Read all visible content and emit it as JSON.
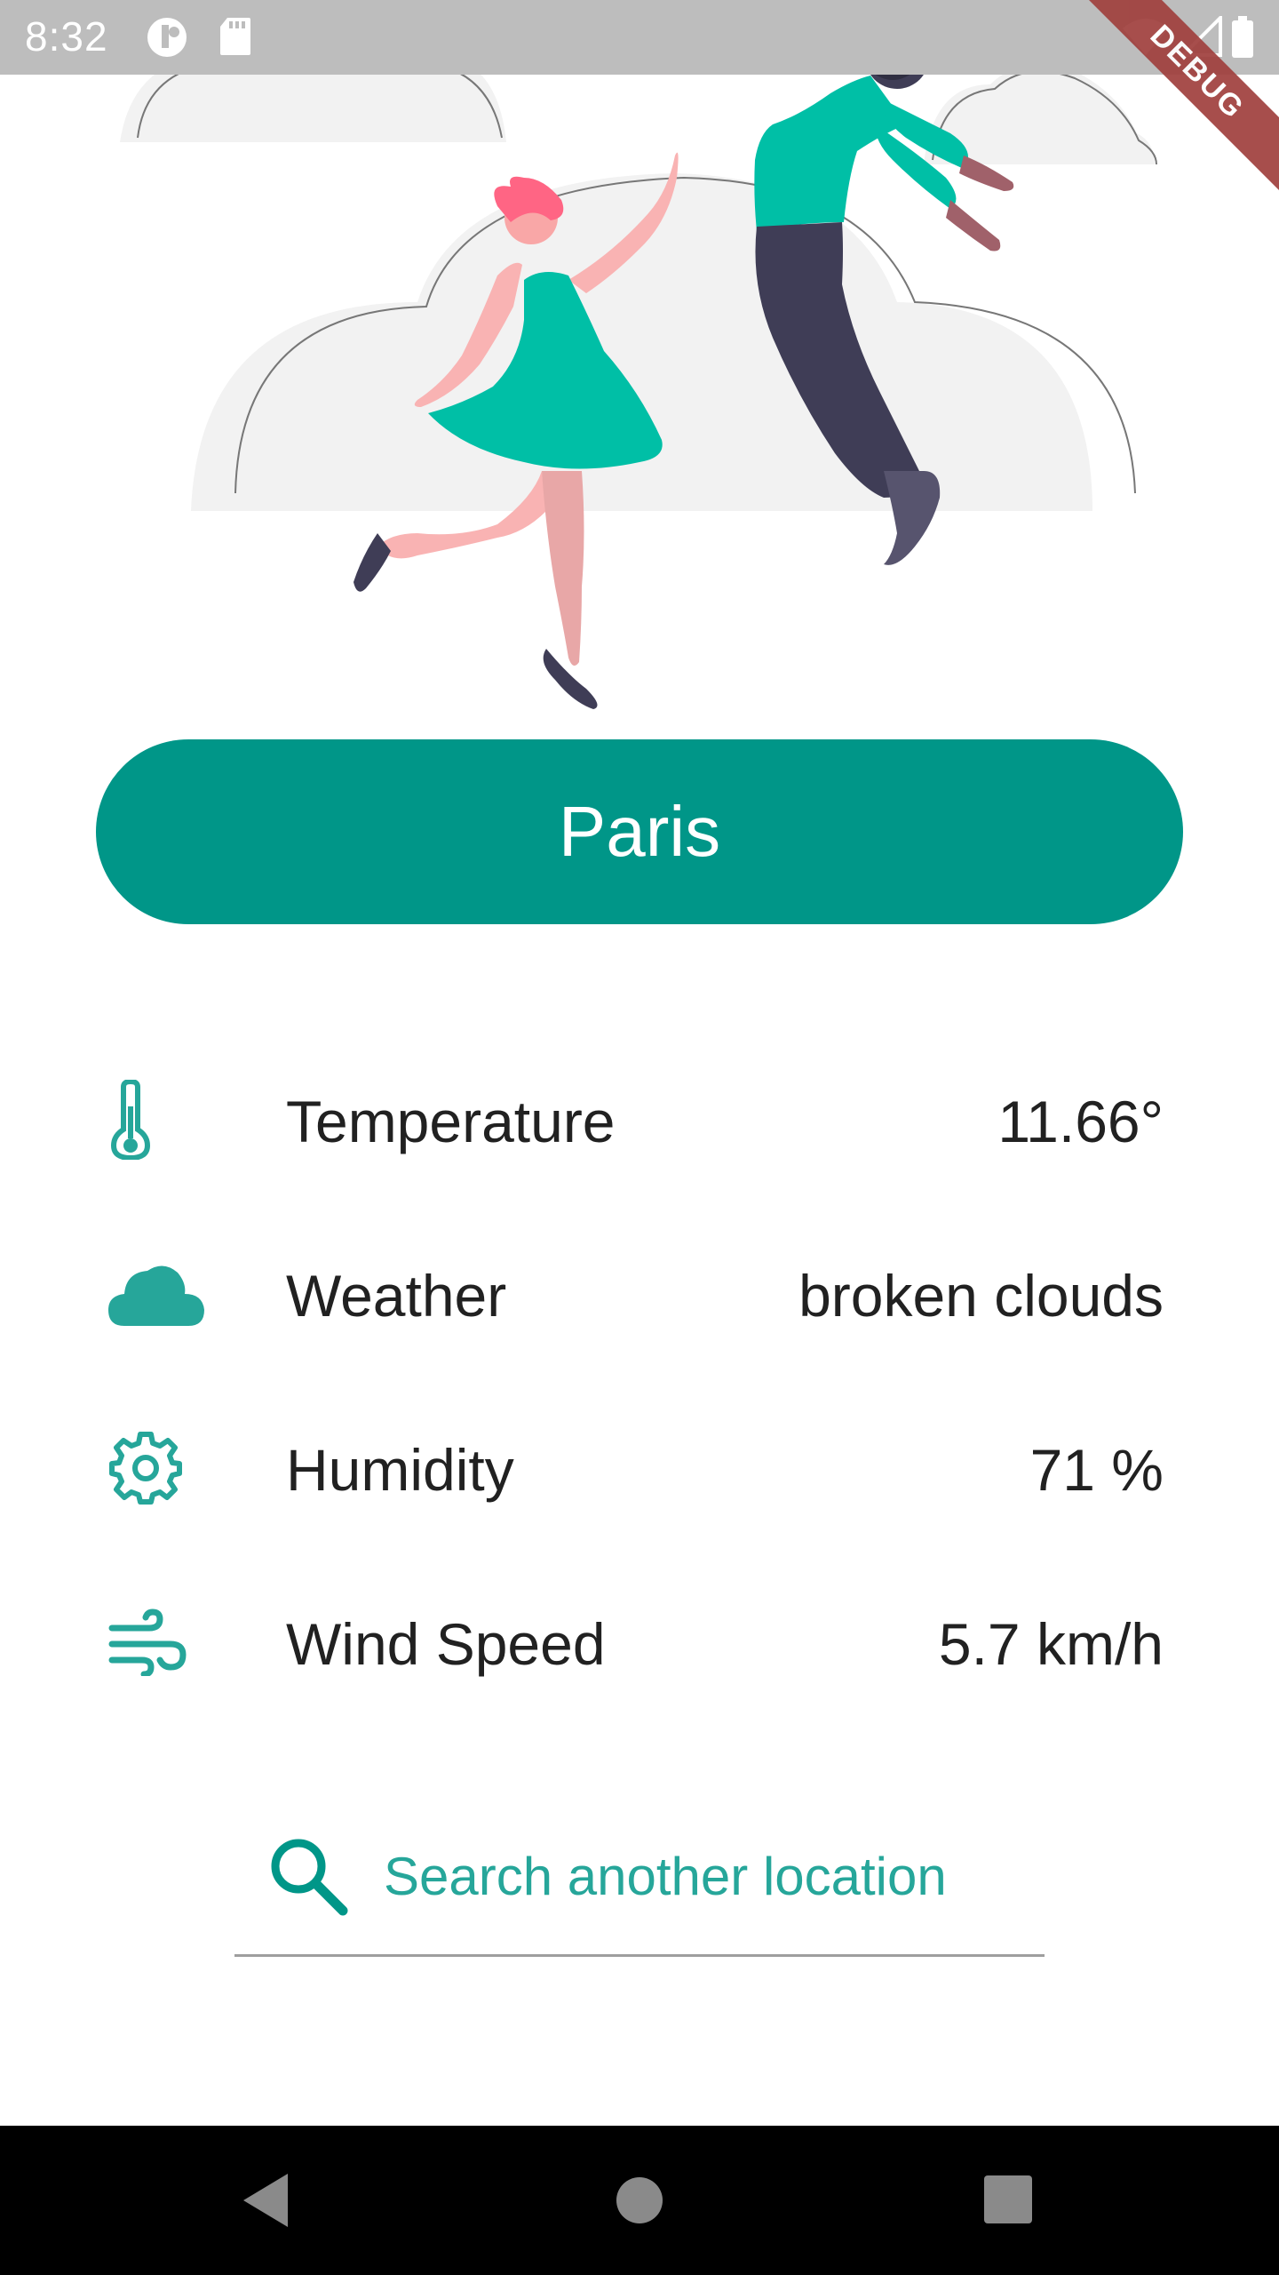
{
  "status_bar": {
    "time": "8:32",
    "icons": [
      "app-notification-icon",
      "sd-card-icon",
      "wifi-icon",
      "signal-icon",
      "battery-icon"
    ]
  },
  "debug_banner": "DEBUG",
  "city": {
    "name": "Paris"
  },
  "weather": {
    "rows": [
      {
        "icon": "thermometer-icon",
        "label": "Temperature",
        "value": "11.66°"
      },
      {
        "icon": "cloud-icon",
        "label": "Weather",
        "value": "broken clouds"
      },
      {
        "icon": "gear-icon",
        "label": "Humidity",
        "value": "71 %"
      },
      {
        "icon": "wind-icon",
        "label": "Wind Speed",
        "value": "5.7 km/h"
      }
    ]
  },
  "search": {
    "placeholder": "Search another location",
    "value": ""
  },
  "nav": {
    "icons": [
      "back-icon",
      "home-icon",
      "recents-icon"
    ]
  },
  "colors": {
    "accent": "#009688",
    "accent_light": "#26a69a",
    "status_bar": "#bdbdbd",
    "nav_bar": "#000000",
    "debug_ribbon": "#a0403d"
  }
}
